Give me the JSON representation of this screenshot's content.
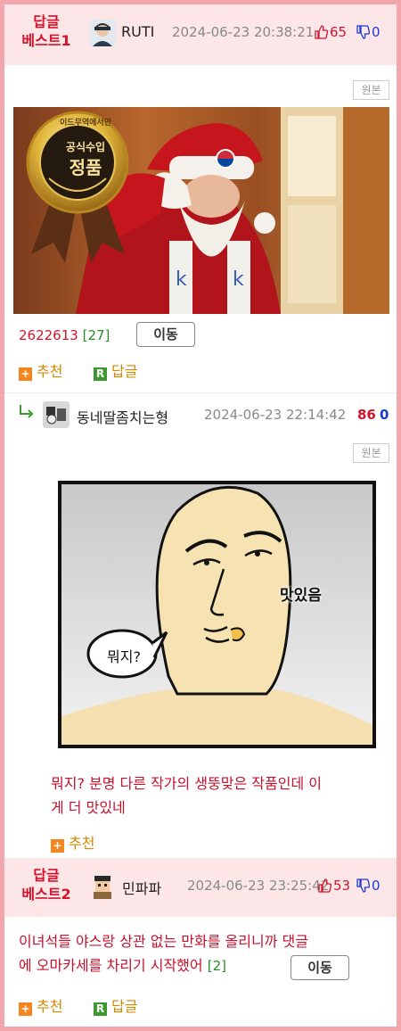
{
  "best1": {
    "label": "답글\n베스트1",
    "nick": "RUTI",
    "date": "2024-06-23 20:38:21",
    "up": "65",
    "down": "0",
    "original_btn": "원본",
    "image": {
      "badge_top": "이드무역에서만",
      "badge_line1": "공식수입",
      "badge_line2": "정품"
    },
    "views": "2622613",
    "comment_count": "[27]",
    "move_btn": "이동",
    "recommend": "추천",
    "reply": "답글"
  },
  "reply1": {
    "nick": "동네딸좀치는형",
    "date": "2024-06-23 22:14:42",
    "up": "86",
    "down": "0",
    "original_btn": "원본",
    "comic": {
      "bubble": "뭐지?",
      "caption": "맛있음"
    },
    "text_line1": "뭐지? 분명 다른 작가의 생뚱맞은 작품인데 이",
    "text_line2": "게 더 맛있네",
    "recommend": "추천"
  },
  "best2": {
    "label": "답글\n베스트2",
    "nick": "민파파",
    "date": "2024-06-23 23:25:42",
    "up": "53",
    "down": "0",
    "text_line1": "이녀석들 야스랑 상관 없는 만화를 올리니까 댓글",
    "text_line2": "에 오마카세를 차리기 시작했어",
    "comment_count": "[2]",
    "move_btn": "이동",
    "recommend": "추천",
    "reply": "답글"
  },
  "colors": {
    "accent": "#d2142c",
    "frame": "#f2a6ad",
    "header_bg": "#fce6e8",
    "down": "#1a3ad6"
  }
}
